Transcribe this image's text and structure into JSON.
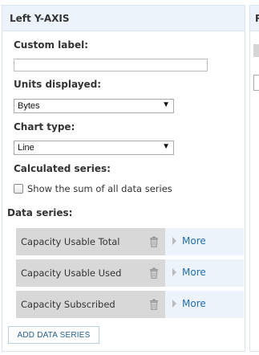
{
  "left_axis": {
    "title": "Left Y-AXIS",
    "custom_label": {
      "label": "Custom label:",
      "value": ""
    },
    "units": {
      "label": "Units displayed:",
      "selected": "Bytes"
    },
    "chart_type": {
      "label": "Chart type:",
      "selected": "Line"
    },
    "calculated_series": {
      "label": "Calculated series:",
      "checkbox_label": "Show the sum of all data series",
      "checked": false
    },
    "data_series": {
      "label": "Data series:",
      "items": [
        {
          "name": "Capacity Usable Total",
          "more": "More"
        },
        {
          "name": "Capacity Usable Used",
          "more": "More"
        },
        {
          "name": "Capacity Subscribed",
          "more": "More"
        }
      ]
    },
    "add_button": "ADD DATA SERIES"
  },
  "right_axis": {
    "title_partial": "R"
  },
  "icons": {
    "dropdown": "dropdown-arrow-icon",
    "delete": "trash-icon",
    "expand": "caret-right-icon"
  },
  "colors": {
    "header_bg": "#ecf3fa",
    "series_bg": "#d8d8d8",
    "link": "#1f6fb2"
  }
}
